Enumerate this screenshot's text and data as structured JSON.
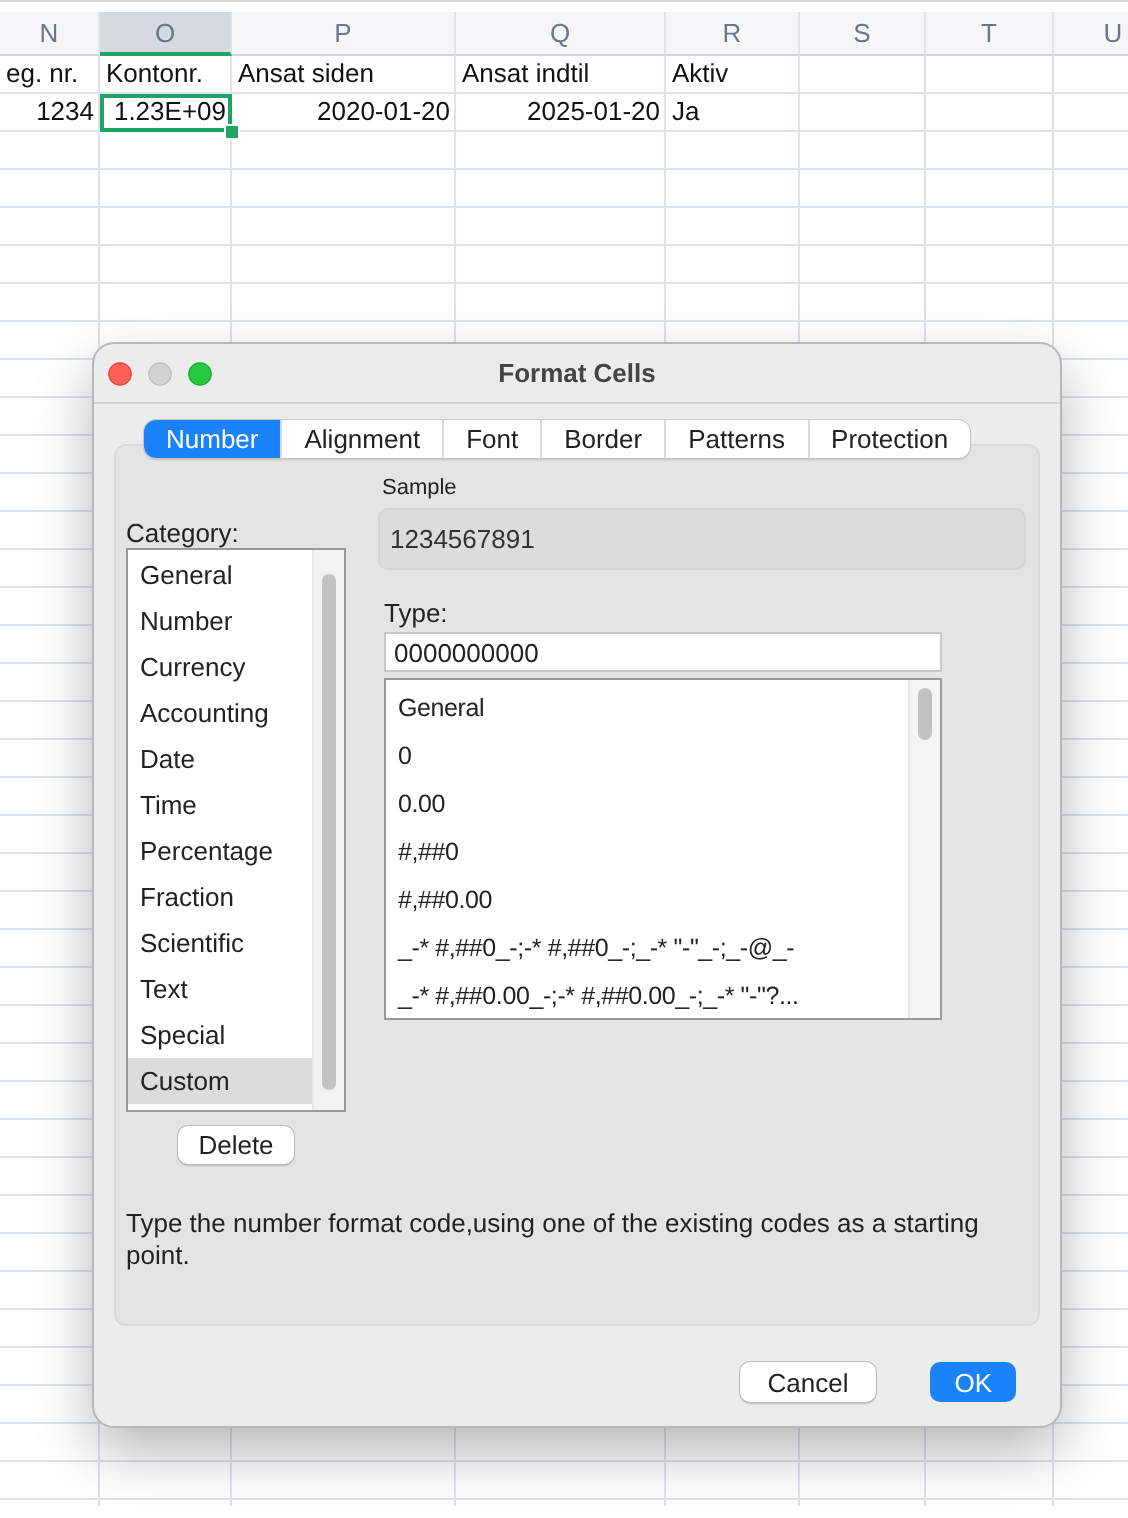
{
  "sheet": {
    "columns": [
      {
        "label": "N",
        "selected": false
      },
      {
        "label": "O",
        "selected": true
      },
      {
        "label": "P",
        "selected": false
      },
      {
        "label": "Q",
        "selected": false
      },
      {
        "label": "R",
        "selected": false
      },
      {
        "label": "S",
        "selected": false
      },
      {
        "label": "T",
        "selected": false
      },
      {
        "label": "U",
        "selected": false
      }
    ],
    "rows": [
      [
        {
          "text": "eg. nr.",
          "kind": "text",
          "selected": false
        },
        {
          "text": "Kontonr.",
          "kind": "text",
          "selected": false
        },
        {
          "text": "Ansat siden",
          "kind": "text",
          "selected": false
        },
        {
          "text": "Ansat indtil",
          "kind": "text",
          "selected": false
        },
        {
          "text": "Aktiv",
          "kind": "text",
          "selected": false
        }
      ],
      [
        {
          "text": "1234",
          "kind": "number",
          "selected": false
        },
        {
          "text": "1.23E+09",
          "kind": "number",
          "selected": true
        },
        {
          "text": "2020-01-20",
          "kind": "number",
          "selected": false
        },
        {
          "text": "2025-01-20",
          "kind": "number",
          "selected": false
        },
        {
          "text": "Ja",
          "kind": "text",
          "selected": false
        }
      ]
    ]
  },
  "dialog": {
    "title": "Format Cells",
    "tabs": [
      {
        "label": "Number",
        "selected": true
      },
      {
        "label": "Alignment",
        "selected": false
      },
      {
        "label": "Font",
        "selected": false
      },
      {
        "label": "Border",
        "selected": false
      },
      {
        "label": "Patterns",
        "selected": false
      },
      {
        "label": "Protection",
        "selected": false
      }
    ],
    "sample": {
      "label": "Sample",
      "value": "1234567891"
    },
    "category": {
      "label": "Category:",
      "items": [
        {
          "label": "General",
          "selected": false
        },
        {
          "label": "Number",
          "selected": false
        },
        {
          "label": "Currency",
          "selected": false
        },
        {
          "label": "Accounting",
          "selected": false
        },
        {
          "label": "Date",
          "selected": false
        },
        {
          "label": "Time",
          "selected": false
        },
        {
          "label": "Percentage",
          "selected": false
        },
        {
          "label": "Fraction",
          "selected": false
        },
        {
          "label": "Scientific",
          "selected": false
        },
        {
          "label": "Text",
          "selected": false
        },
        {
          "label": "Special",
          "selected": false
        },
        {
          "label": "Custom",
          "selected": true
        }
      ]
    },
    "type": {
      "label": "Type:",
      "value": "0000000000",
      "formats": [
        "General",
        "0",
        "0.00",
        "#,##0",
        "#,##0.00",
        "_-* #,##0_-;-* #,##0_-;_-* \"-\"_-;_-@_-",
        "_-* #,##0.00_-;-* #,##0.00_-;_-* \"-\"?..."
      ]
    },
    "delete_button": "Delete",
    "description": "Type the number format code,using one of the existing codes as a starting point.",
    "buttons": [
      {
        "label": "Cancel",
        "kind": "default"
      },
      {
        "label": "OK",
        "kind": "primary"
      }
    ]
  }
}
